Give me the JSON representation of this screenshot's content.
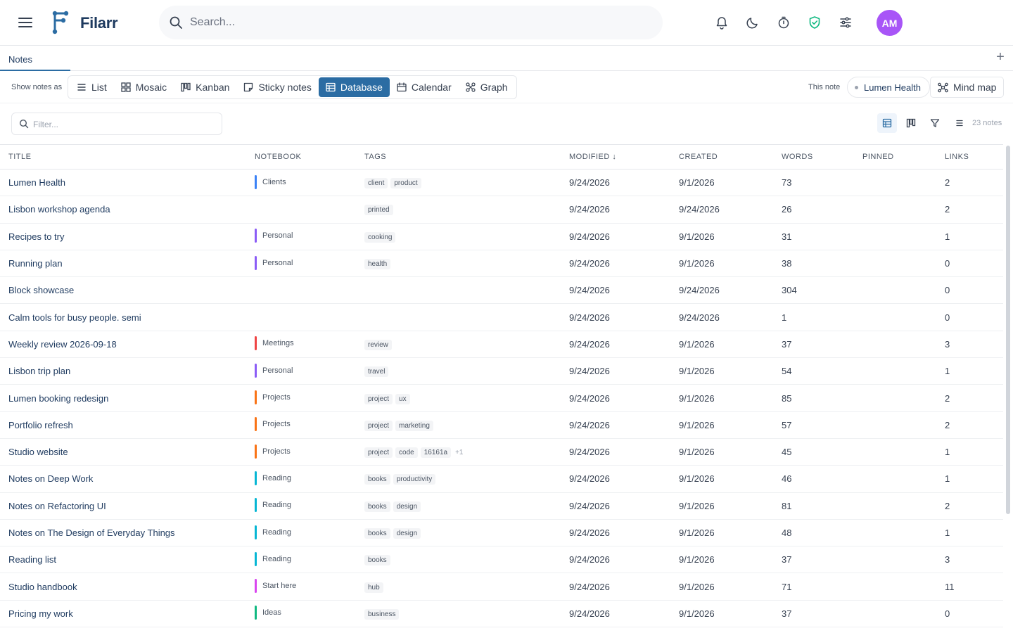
{
  "app": {
    "name": "Filarr"
  },
  "search": {
    "placeholder": "Search..."
  },
  "user": {
    "initials": "AM"
  },
  "tabs": [
    {
      "label": "Notes"
    }
  ],
  "views": {
    "show_label": "Show notes as",
    "items": [
      {
        "label": "List",
        "icon": "list-icon"
      },
      {
        "label": "Mosaic",
        "icon": "mosaic-icon"
      },
      {
        "label": "Kanban",
        "icon": "kanban-icon"
      },
      {
        "label": "Sticky notes",
        "icon": "sticky-note-icon"
      },
      {
        "label": "Database",
        "icon": "database-icon",
        "active": true
      },
      {
        "label": "Calendar",
        "icon": "calendar-icon"
      },
      {
        "label": "Graph",
        "icon": "graph-icon"
      }
    ],
    "this_note_label": "This note",
    "this_note_value": "Lumen Health",
    "mindmap_label": "Mind map"
  },
  "filter": {
    "placeholder": "Filter...",
    "count_label": "23 notes"
  },
  "colors": {
    "accent": "#2b6ca3",
    "notebooks": {
      "Clients": "#3b82f6",
      "Personal": "#8b5cf6",
      "Meetings": "#ef4444",
      "Projects": "#f97316",
      "Reading": "#06b6d4",
      "Start here": "#d946ef",
      "Ideas": "#10b981"
    }
  },
  "table": {
    "columns": [
      "TITLE",
      "NOTEBOOK",
      "TAGS",
      "MODIFIED ↓",
      "CREATED",
      "WORDS",
      "PINNED",
      "LINKS"
    ],
    "rows": [
      {
        "title": "Lumen Health",
        "notebook": "Clients",
        "tags": [
          "client",
          "product"
        ],
        "more": "",
        "modified": "9/24/2026",
        "created": "9/1/2026",
        "words": "73",
        "pinned": "",
        "links": "2"
      },
      {
        "title": "Lisbon workshop agenda",
        "notebook": "",
        "tags": [
          "printed"
        ],
        "more": "",
        "modified": "9/24/2026",
        "created": "9/24/2026",
        "words": "26",
        "pinned": "",
        "links": "2"
      },
      {
        "title": "Recipes to try",
        "notebook": "Personal",
        "tags": [
          "cooking"
        ],
        "more": "",
        "modified": "9/24/2026",
        "created": "9/1/2026",
        "words": "31",
        "pinned": "",
        "links": "1"
      },
      {
        "title": "Running plan",
        "notebook": "Personal",
        "tags": [
          "health"
        ],
        "more": "",
        "modified": "9/24/2026",
        "created": "9/1/2026",
        "words": "38",
        "pinned": "",
        "links": "0"
      },
      {
        "title": "Block showcase",
        "notebook": "",
        "tags": [],
        "more": "",
        "modified": "9/24/2026",
        "created": "9/24/2026",
        "words": "304",
        "pinned": "",
        "links": "0"
      },
      {
        "title": "Calm tools for busy people. semi",
        "notebook": "",
        "tags": [],
        "more": "",
        "modified": "9/24/2026",
        "created": "9/24/2026",
        "words": "1",
        "pinned": "",
        "links": "0"
      },
      {
        "title": "Weekly review 2026-09-18",
        "notebook": "Meetings",
        "tags": [
          "review"
        ],
        "more": "",
        "modified": "9/24/2026",
        "created": "9/1/2026",
        "words": "37",
        "pinned": "",
        "links": "3"
      },
      {
        "title": "Lisbon trip plan",
        "notebook": "Personal",
        "tags": [
          "travel"
        ],
        "more": "",
        "modified": "9/24/2026",
        "created": "9/1/2026",
        "words": "54",
        "pinned": "",
        "links": "1"
      },
      {
        "title": "Lumen booking redesign",
        "notebook": "Projects",
        "tags": [
          "project",
          "ux"
        ],
        "more": "",
        "modified": "9/24/2026",
        "created": "9/1/2026",
        "words": "85",
        "pinned": "",
        "links": "2"
      },
      {
        "title": "Portfolio refresh",
        "notebook": "Projects",
        "tags": [
          "project",
          "marketing"
        ],
        "more": "",
        "modified": "9/24/2026",
        "created": "9/1/2026",
        "words": "57",
        "pinned": "",
        "links": "2"
      },
      {
        "title": "Studio website",
        "notebook": "Projects",
        "tags": [
          "project",
          "code",
          "16161a"
        ],
        "more": "+1",
        "modified": "9/24/2026",
        "created": "9/1/2026",
        "words": "45",
        "pinned": "",
        "links": "1"
      },
      {
        "title": "Notes on Deep Work",
        "notebook": "Reading",
        "tags": [
          "books",
          "productivity"
        ],
        "more": "",
        "modified": "9/24/2026",
        "created": "9/1/2026",
        "words": "46",
        "pinned": "",
        "links": "1"
      },
      {
        "title": "Notes on Refactoring UI",
        "notebook": "Reading",
        "tags": [
          "books",
          "design"
        ],
        "more": "",
        "modified": "9/24/2026",
        "created": "9/1/2026",
        "words": "81",
        "pinned": "",
        "links": "2"
      },
      {
        "title": "Notes on The Design of Everyday Things",
        "notebook": "Reading",
        "tags": [
          "books",
          "design"
        ],
        "more": "",
        "modified": "9/24/2026",
        "created": "9/1/2026",
        "words": "48",
        "pinned": "",
        "links": "1"
      },
      {
        "title": "Reading list",
        "notebook": "Reading",
        "tags": [
          "books"
        ],
        "more": "",
        "modified": "9/24/2026",
        "created": "9/1/2026",
        "words": "37",
        "pinned": "",
        "links": "3"
      },
      {
        "title": "Studio handbook",
        "notebook": "Start here",
        "tags": [
          "hub"
        ],
        "more": "",
        "modified": "9/24/2026",
        "created": "9/1/2026",
        "words": "71",
        "pinned": "",
        "links": "11"
      },
      {
        "title": "Pricing my work",
        "notebook": "Ideas",
        "tags": [
          "business"
        ],
        "more": "",
        "modified": "9/24/2026",
        "created": "9/1/2026",
        "words": "37",
        "pinned": "",
        "links": "0"
      }
    ]
  }
}
